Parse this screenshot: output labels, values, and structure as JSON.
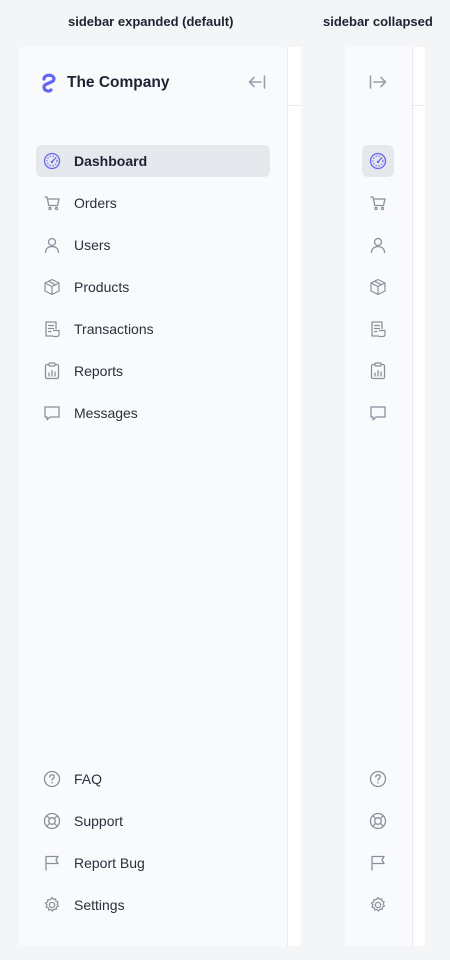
{
  "captions": {
    "expanded": "sidebar expanded (default)",
    "collapsed": "sidebar collapsed"
  },
  "brand": {
    "name": "The Company",
    "logo_icon": "company-logo"
  },
  "accent_color": "#6366f1",
  "nav": {
    "active": "dashboard",
    "primary": [
      {
        "id": "dashboard",
        "label": "Dashboard",
        "icon": "gauge-icon"
      },
      {
        "id": "orders",
        "label": "Orders",
        "icon": "cart-icon"
      },
      {
        "id": "users",
        "label": "Users",
        "icon": "user-icon"
      },
      {
        "id": "products",
        "label": "Products",
        "icon": "box-icon"
      },
      {
        "id": "transactions",
        "label": "Transactions",
        "icon": "receipt-icon"
      },
      {
        "id": "reports",
        "label": "Reports",
        "icon": "clipboard-chart-icon"
      },
      {
        "id": "messages",
        "label": "Messages",
        "icon": "message-icon"
      }
    ],
    "secondary": [
      {
        "id": "faq",
        "label": "FAQ",
        "icon": "question-icon"
      },
      {
        "id": "support",
        "label": "Support",
        "icon": "lifebuoy-icon"
      },
      {
        "id": "report-bug",
        "label": "Report Bug",
        "icon": "flag-icon"
      },
      {
        "id": "settings",
        "label": "Settings",
        "icon": "gear-icon"
      }
    ]
  }
}
